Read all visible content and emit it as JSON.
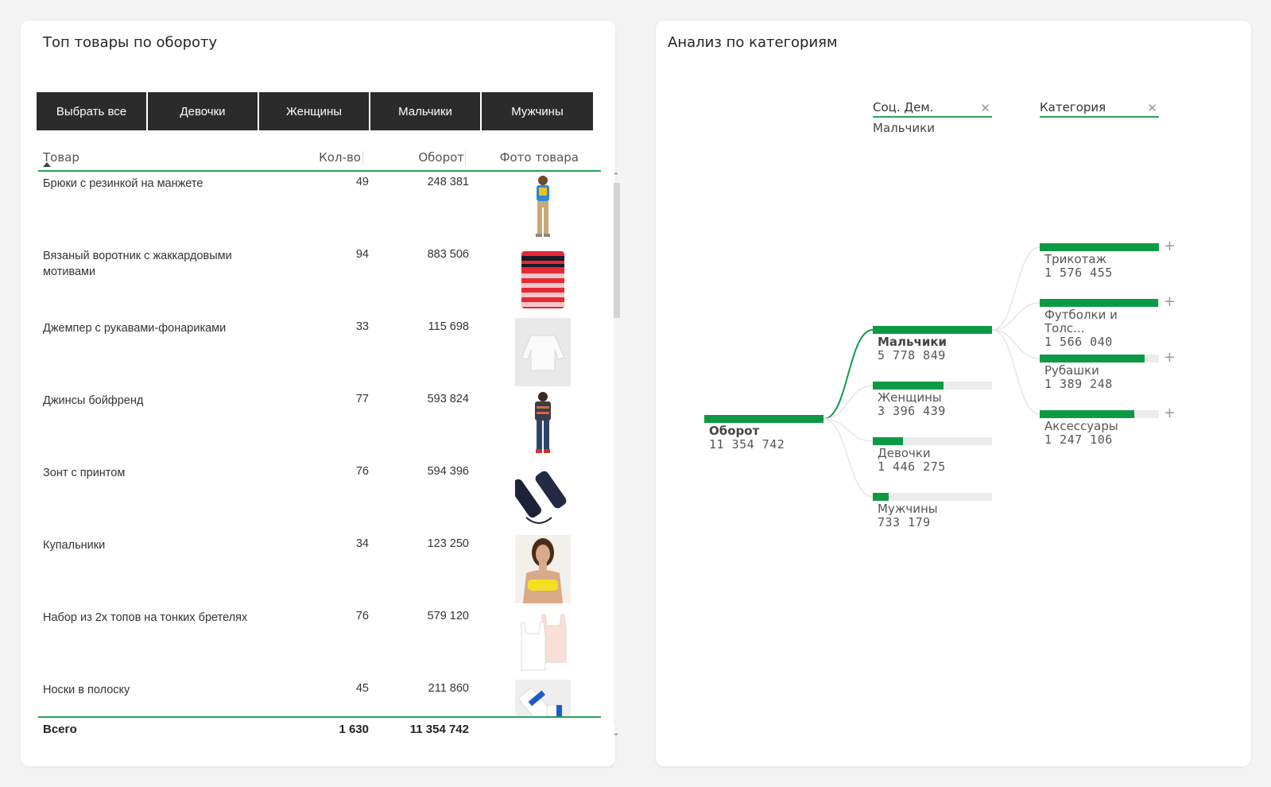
{
  "left_panel": {
    "title": "Топ товары по обороту",
    "filters": [
      "Выбрать все",
      "Девочки",
      "Женщины",
      "Мальчики",
      "Мужчины"
    ],
    "table": {
      "columns": {
        "name": "Товар",
        "qty": "Кол-во",
        "revenue": "Оборот",
        "photo": "Фото товара"
      },
      "rows": [
        {
          "name": "Брюки с резинкой на манжете",
          "qty": "49",
          "revenue": "248 381",
          "photo": "girl-in-blue-top-and-khaki-pants"
        },
        {
          "name": "Вязаный воротник с жаккардовыми мотивами",
          "qty": "94",
          "revenue": "883 506",
          "photo": "red-striped-knit-collar"
        },
        {
          "name": "Джемпер с рукавами-фонариками",
          "qty": "33",
          "revenue": "115 698",
          "photo": "white-jumper"
        },
        {
          "name": "Джинсы бойфренд",
          "qty": "77",
          "revenue": "593 824",
          "photo": "woman-in-boyfriend-jeans"
        },
        {
          "name": "Зонт с принтом",
          "qty": "76",
          "revenue": "594 396",
          "photo": "folded-navy-umbrella"
        },
        {
          "name": "Купальники",
          "qty": "34",
          "revenue": "123 250",
          "photo": "woman-in-yellow-swimsuit"
        },
        {
          "name": "Набор из 2х топов на тонких бретелях",
          "qty": "76",
          "revenue": "579 120",
          "photo": "white-and-pink-tank-tops"
        },
        {
          "name": "Носки в полоску",
          "qty": "45",
          "revenue": "211 860",
          "photo": "blue-striped-socks"
        }
      ],
      "total": {
        "label": "Всего",
        "qty": "1 630",
        "revenue": "11 354 742"
      }
    }
  },
  "right_panel": {
    "title": "Анализ по категориям",
    "levels": [
      {
        "label": "Соц. Дем.",
        "selected": "Мальчики"
      },
      {
        "label": "Категория",
        "selected": ""
      }
    ],
    "chart_data": {
      "type": "decomposition-tree",
      "root": {
        "label": "Оборот",
        "value": "11 354 742"
      },
      "level1": [
        {
          "label": "Мальчики",
          "value": "5 778 849",
          "fraction": 1.0,
          "selected": true
        },
        {
          "label": "Женщины",
          "value": "3 396 439",
          "fraction": 0.59
        },
        {
          "label": "Девочки",
          "value": "1 446 275",
          "fraction": 0.25
        },
        {
          "label": "Мужчины",
          "value": "733 179",
          "fraction": 0.13
        }
      ],
      "level2": [
        {
          "label": "Трикотаж",
          "value": "1 576 455",
          "fraction": 1.0
        },
        {
          "label": "Футболки и Толс...",
          "value": "1 566 040",
          "fraction": 0.99
        },
        {
          "label": "Рубашки",
          "value": "1 389 248",
          "fraction": 0.88
        },
        {
          "label": "Аксессуары",
          "value": "1 247 106",
          "fraction": 0.79
        }
      ]
    }
  }
}
